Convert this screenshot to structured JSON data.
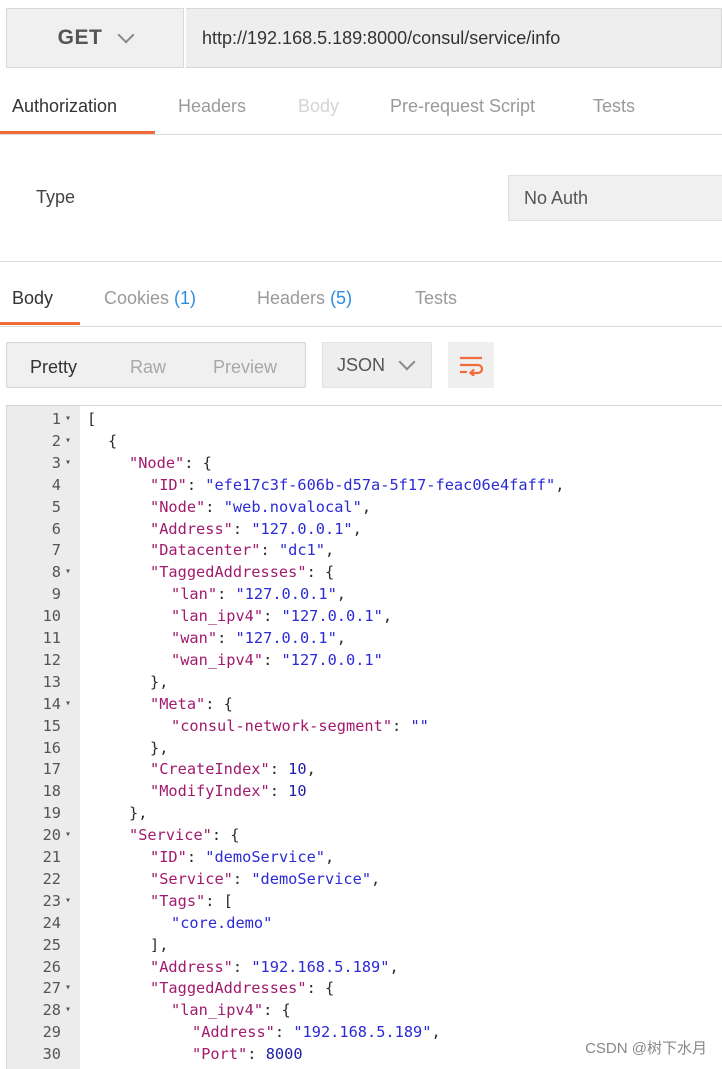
{
  "request": {
    "method": "GET",
    "url": "http://192.168.5.189:8000/consul/service/info"
  },
  "request_tabs": [
    {
      "label": "Authorization",
      "state": "active"
    },
    {
      "label": "Headers",
      "state": "normal"
    },
    {
      "label": "Body",
      "state": "disabled"
    },
    {
      "label": "Pre-request Script",
      "state": "normal"
    },
    {
      "label": "Tests",
      "state": "normal"
    }
  ],
  "auth": {
    "type_label": "Type",
    "type_value": "No Auth"
  },
  "response_tabs": [
    {
      "label": "Body",
      "count": ""
    },
    {
      "label": "Cookies",
      "count": "(1)"
    },
    {
      "label": "Headers",
      "count": "(5)"
    },
    {
      "label": "Tests",
      "count": ""
    }
  ],
  "view_modes": [
    "Pretty",
    "Raw",
    "Preview"
  ],
  "format": "JSON",
  "icons": {
    "method_dropdown": "chevron-down-icon",
    "format_dropdown": "chevron-down-icon",
    "wrap": "wrap-lines-icon"
  },
  "colors": {
    "accent": "#f26b3a",
    "key": "#a21a6e",
    "string": "#2a2ad6",
    "count": "#2c8de0"
  },
  "code_lines": [
    {
      "n": "1",
      "fold": true,
      "indent": 0,
      "tokens": [
        {
          "t": "p",
          "v": "["
        }
      ]
    },
    {
      "n": "2",
      "fold": true,
      "indent": 1,
      "tokens": [
        {
          "t": "p",
          "v": "{"
        }
      ]
    },
    {
      "n": "3",
      "fold": true,
      "indent": 2,
      "tokens": [
        {
          "t": "k",
          "v": "\"Node\""
        },
        {
          "t": "p",
          "v": ": {"
        }
      ]
    },
    {
      "n": "4",
      "fold": false,
      "indent": 3,
      "tokens": [
        {
          "t": "k",
          "v": "\"ID\""
        },
        {
          "t": "p",
          "v": ": "
        },
        {
          "t": "s",
          "v": "\"efe17c3f-606b-d57a-5f17-feac06e4faff\""
        },
        {
          "t": "p",
          "v": ","
        }
      ]
    },
    {
      "n": "5",
      "fold": false,
      "indent": 3,
      "tokens": [
        {
          "t": "k",
          "v": "\"Node\""
        },
        {
          "t": "p",
          "v": ": "
        },
        {
          "t": "s",
          "v": "\"web.novalocal\""
        },
        {
          "t": "p",
          "v": ","
        }
      ]
    },
    {
      "n": "6",
      "fold": false,
      "indent": 3,
      "tokens": [
        {
          "t": "k",
          "v": "\"Address\""
        },
        {
          "t": "p",
          "v": ": "
        },
        {
          "t": "s",
          "v": "\"127.0.0.1\""
        },
        {
          "t": "p",
          "v": ","
        }
      ]
    },
    {
      "n": "7",
      "fold": false,
      "indent": 3,
      "tokens": [
        {
          "t": "k",
          "v": "\"Datacenter\""
        },
        {
          "t": "p",
          "v": ": "
        },
        {
          "t": "s",
          "v": "\"dc1\""
        },
        {
          "t": "p",
          "v": ","
        }
      ]
    },
    {
      "n": "8",
      "fold": true,
      "indent": 3,
      "tokens": [
        {
          "t": "k",
          "v": "\"TaggedAddresses\""
        },
        {
          "t": "p",
          "v": ": {"
        }
      ]
    },
    {
      "n": "9",
      "fold": false,
      "indent": 4,
      "tokens": [
        {
          "t": "k",
          "v": "\"lan\""
        },
        {
          "t": "p",
          "v": ": "
        },
        {
          "t": "s",
          "v": "\"127.0.0.1\""
        },
        {
          "t": "p",
          "v": ","
        }
      ]
    },
    {
      "n": "10",
      "fold": false,
      "indent": 4,
      "tokens": [
        {
          "t": "k",
          "v": "\"lan_ipv4\""
        },
        {
          "t": "p",
          "v": ": "
        },
        {
          "t": "s",
          "v": "\"127.0.0.1\""
        },
        {
          "t": "p",
          "v": ","
        }
      ]
    },
    {
      "n": "11",
      "fold": false,
      "indent": 4,
      "tokens": [
        {
          "t": "k",
          "v": "\"wan\""
        },
        {
          "t": "p",
          "v": ": "
        },
        {
          "t": "s",
          "v": "\"127.0.0.1\""
        },
        {
          "t": "p",
          "v": ","
        }
      ]
    },
    {
      "n": "12",
      "fold": false,
      "indent": 4,
      "tokens": [
        {
          "t": "k",
          "v": "\"wan_ipv4\""
        },
        {
          "t": "p",
          "v": ": "
        },
        {
          "t": "s",
          "v": "\"127.0.0.1\""
        }
      ]
    },
    {
      "n": "13",
      "fold": false,
      "indent": 3,
      "tokens": [
        {
          "t": "p",
          "v": "},"
        }
      ]
    },
    {
      "n": "14",
      "fold": true,
      "indent": 3,
      "tokens": [
        {
          "t": "k",
          "v": "\"Meta\""
        },
        {
          "t": "p",
          "v": ": {"
        }
      ]
    },
    {
      "n": "15",
      "fold": false,
      "indent": 4,
      "tokens": [
        {
          "t": "k",
          "v": "\"consul-network-segment\""
        },
        {
          "t": "p",
          "v": ": "
        },
        {
          "t": "s",
          "v": "\"\""
        }
      ]
    },
    {
      "n": "16",
      "fold": false,
      "indent": 3,
      "tokens": [
        {
          "t": "p",
          "v": "},"
        }
      ]
    },
    {
      "n": "17",
      "fold": false,
      "indent": 3,
      "tokens": [
        {
          "t": "k",
          "v": "\"CreateIndex\""
        },
        {
          "t": "p",
          "v": ": "
        },
        {
          "t": "n",
          "v": "10"
        },
        {
          "t": "p",
          "v": ","
        }
      ]
    },
    {
      "n": "18",
      "fold": false,
      "indent": 3,
      "tokens": [
        {
          "t": "k",
          "v": "\"ModifyIndex\""
        },
        {
          "t": "p",
          "v": ": "
        },
        {
          "t": "n",
          "v": "10"
        }
      ]
    },
    {
      "n": "19",
      "fold": false,
      "indent": 2,
      "tokens": [
        {
          "t": "p",
          "v": "},"
        }
      ]
    },
    {
      "n": "20",
      "fold": true,
      "indent": 2,
      "tokens": [
        {
          "t": "k",
          "v": "\"Service\""
        },
        {
          "t": "p",
          "v": ": {"
        }
      ]
    },
    {
      "n": "21",
      "fold": false,
      "indent": 3,
      "tokens": [
        {
          "t": "k",
          "v": "\"ID\""
        },
        {
          "t": "p",
          "v": ": "
        },
        {
          "t": "s",
          "v": "\"demoService\""
        },
        {
          "t": "p",
          "v": ","
        }
      ]
    },
    {
      "n": "22",
      "fold": false,
      "indent": 3,
      "tokens": [
        {
          "t": "k",
          "v": "\"Service\""
        },
        {
          "t": "p",
          "v": ": "
        },
        {
          "t": "s",
          "v": "\"demoService\""
        },
        {
          "t": "p",
          "v": ","
        }
      ]
    },
    {
      "n": "23",
      "fold": true,
      "indent": 3,
      "tokens": [
        {
          "t": "k",
          "v": "\"Tags\""
        },
        {
          "t": "p",
          "v": ": ["
        }
      ]
    },
    {
      "n": "24",
      "fold": false,
      "indent": 4,
      "tokens": [
        {
          "t": "s",
          "v": "\"core.demo\""
        }
      ]
    },
    {
      "n": "25",
      "fold": false,
      "indent": 3,
      "tokens": [
        {
          "t": "p",
          "v": "],"
        }
      ]
    },
    {
      "n": "26",
      "fold": false,
      "indent": 3,
      "tokens": [
        {
          "t": "k",
          "v": "\"Address\""
        },
        {
          "t": "p",
          "v": ": "
        },
        {
          "t": "s",
          "v": "\"192.168.5.189\""
        },
        {
          "t": "p",
          "v": ","
        }
      ]
    },
    {
      "n": "27",
      "fold": true,
      "indent": 3,
      "tokens": [
        {
          "t": "k",
          "v": "\"TaggedAddresses\""
        },
        {
          "t": "p",
          "v": ": {"
        }
      ]
    },
    {
      "n": "28",
      "fold": true,
      "indent": 4,
      "tokens": [
        {
          "t": "k",
          "v": "\"lan_ipv4\""
        },
        {
          "t": "p",
          "v": ": {"
        }
      ]
    },
    {
      "n": "29",
      "fold": false,
      "indent": 5,
      "tokens": [
        {
          "t": "k",
          "v": "\"Address\""
        },
        {
          "t": "p",
          "v": ": "
        },
        {
          "t": "s",
          "v": "\"192.168.5.189\""
        },
        {
          "t": "p",
          "v": ","
        }
      ]
    },
    {
      "n": "30",
      "fold": false,
      "indent": 5,
      "tokens": [
        {
          "t": "k",
          "v": "\"Port\""
        },
        {
          "t": "p",
          "v": ": "
        },
        {
          "t": "n",
          "v": "8000"
        }
      ]
    }
  ],
  "watermark": "CSDN @树下水月"
}
